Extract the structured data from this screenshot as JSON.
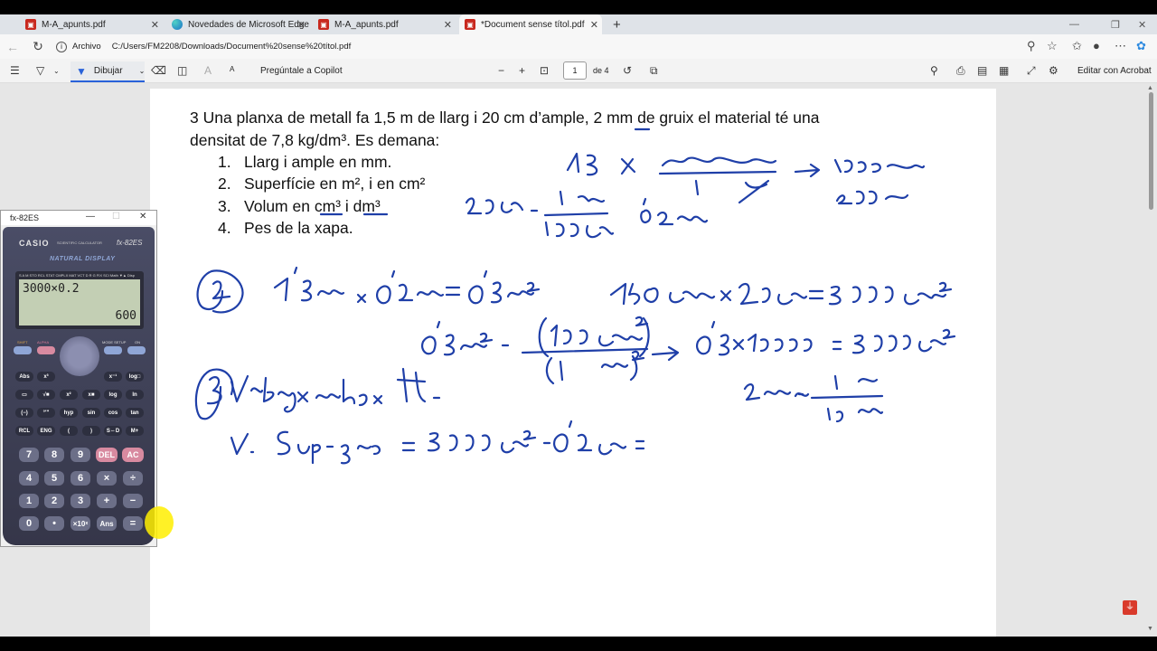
{
  "tabs": [
    {
      "title": "M-A_apunts.pdf",
      "icon": "pdf-icon",
      "active": false
    },
    {
      "title": "Novedades de Microsoft Edge",
      "icon": "edge-icon",
      "active": false
    },
    {
      "title": "M-A_apunts.pdf",
      "icon": "pdf-icon",
      "active": false
    },
    {
      "title": "*Document sense títol.pdf",
      "icon": "pdf-icon",
      "active": true
    }
  ],
  "address": {
    "label": "Archivo",
    "url": "C:/Users/FM2208/Downloads/Document%20sense%20títol.pdf"
  },
  "pdf_toolbar": {
    "draw_label": "Dibujar",
    "copilot_label": "Pregúntale a Copilot",
    "page_current": "1",
    "page_total": "de 4",
    "acrobat_label": "Editar con Acrobat"
  },
  "document": {
    "line1": "3 Una planxa de metall fa 1,5  m de llarg i 20 cm d’ample, 2  mm de gruix  el material té una",
    "line2": "densitat de 7,8 kg/dm³. Es demana:",
    "items": [
      {
        "num": "1.",
        "text": "Llarg i ample en mm."
      },
      {
        "num": "2.",
        "text": "Superfície en m², i en cm²"
      },
      {
        "num": "3.",
        "text": "Volum en cm³ i dm³"
      },
      {
        "num": "4.",
        "text": "Pes de la xapa."
      }
    ]
  },
  "calculator": {
    "window_title": "fx-82ES",
    "brand": "CASIO",
    "subtitle": "SCIENTIFIC CALCULATOR",
    "model": "fx-82ES",
    "natural_display": "NATURAL DISPLAY",
    "status_line": "S A M STO RCL STAT CMPLX MAT VCT D R G FIX SCI Math ▼▲ Disp",
    "input": "3000×0.2",
    "result": "600",
    "keys": {
      "shift": "SHIFT",
      "alpha": "ALPHA",
      "mode": "MODE SETUP",
      "on": "ON",
      "row1": [
        "Abs",
        "x³",
        "x⁻¹",
        "log□"
      ],
      "row2": [
        "▭",
        "√■",
        "x²",
        "x■",
        "log",
        "ln"
      ],
      "row3": [
        "(−)",
        "°'\"",
        "hyp",
        "sin",
        "cos",
        "tan"
      ],
      "row4": [
        "RCL",
        "ENG",
        "(",
        ")",
        "S⇔D",
        "M+"
      ],
      "num1": [
        "7",
        "8",
        "9",
        "DEL",
        "AC"
      ],
      "num2": [
        "4",
        "5",
        "6",
        "×",
        "÷"
      ],
      "num3": [
        "1",
        "2",
        "3",
        "+",
        "−"
      ],
      "num4": [
        "0",
        "•",
        "×10ˣ",
        "Ans",
        "="
      ]
    }
  },
  "colors": {
    "ink": "#1f3fa8",
    "accent": "#2962d9",
    "pdf_red": "#c8281e"
  }
}
